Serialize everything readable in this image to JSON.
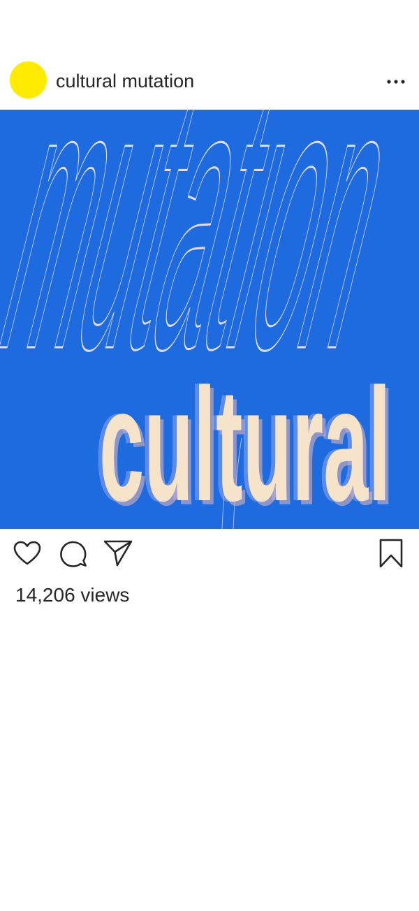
{
  "post": {
    "username": "cultural mutation",
    "avatar_color": "#FFEB00",
    "more_icon": "more-horizontal-icon",
    "views_text": "14,206 views"
  },
  "media": {
    "background_color": "#1E6BE0",
    "outline_word": "mutation",
    "fill_word": "cultural",
    "fill_color": "#F6E4CA",
    "outline_color": "#E2DDF6"
  },
  "actions": {
    "like_icon": "heart-icon",
    "comment_icon": "comment-icon",
    "share_icon": "send-icon",
    "save_icon": "bookmark-icon"
  }
}
